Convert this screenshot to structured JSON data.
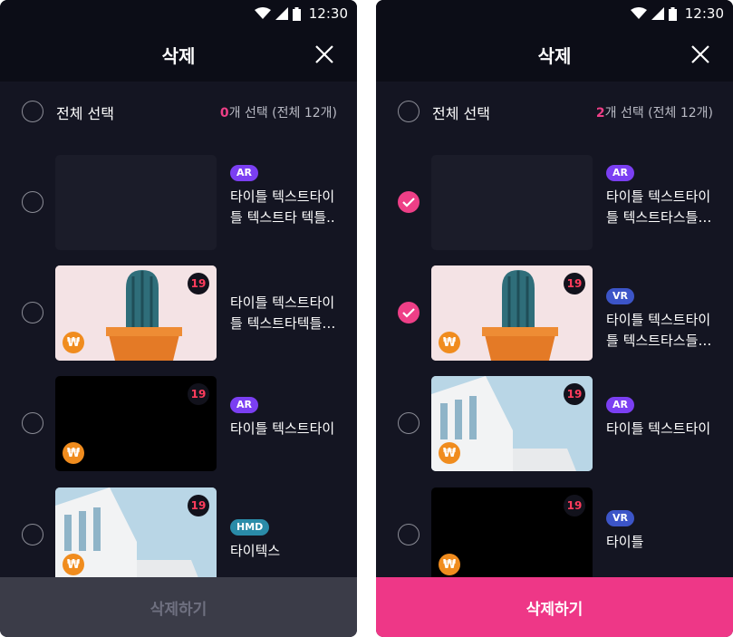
{
  "status": {
    "time": "12:30"
  },
  "colors": {
    "accent": "#ee3787",
    "background": "#141522",
    "header": "#0c0d17",
    "ar_badge": "#7b3ff2",
    "vr_badge": "#3c55c8",
    "hmd_badge": "#2a8ba8",
    "won_badge": "#f08c1e"
  },
  "left": {
    "title": "삭제",
    "select_all": "전체 선택",
    "count_num": "0",
    "count_suffix": "개 선택 (전체 12개)",
    "items": [
      {
        "badge": "AR",
        "text": "타이틀 텍스트타이틀 텍스트타 텍틀..",
        "age": "",
        "checked": false,
        "thumb": "empty-dark"
      },
      {
        "badge": "",
        "text": "타이틀 텍스트타이틀 텍스트타텍틀…",
        "age": "19",
        "price_icon": "₩",
        "checked": false,
        "thumb": "cactus"
      },
      {
        "badge": "AR",
        "text": "타이틀 텍스트타이",
        "age": "19",
        "price_icon": "₩",
        "checked": false,
        "thumb": "black"
      },
      {
        "badge": "HMD",
        "text": "타이텍스",
        "age": "19",
        "price_icon": "₩",
        "checked": false,
        "thumb": "building"
      }
    ],
    "delete_button": "삭제하기"
  },
  "right": {
    "title": "삭제",
    "select_all": "전체 선택",
    "count_num": "2",
    "count_suffix": "개 선택 (전체 12개)",
    "items": [
      {
        "badge": "AR",
        "text": "타이틀 텍스트타이틀 텍스트타스틀…",
        "age": "",
        "checked": true,
        "thumb": "empty-dark"
      },
      {
        "badge": "VR",
        "text": "타이틀 텍스트타이틀 텍스트타스들…",
        "age": "19",
        "price_icon": "₩",
        "checked": true,
        "thumb": "cactus"
      },
      {
        "badge": "AR",
        "text": "타이틀 텍스트타이",
        "age": "19",
        "price_icon": "₩",
        "checked": false,
        "thumb": "building"
      },
      {
        "badge": "VR",
        "text": "타이틀",
        "age": "19",
        "price_icon": "₩",
        "checked": false,
        "thumb": "black"
      }
    ],
    "delete_button": "삭제하기"
  }
}
